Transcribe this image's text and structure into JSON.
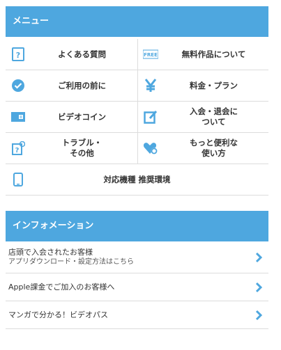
{
  "menu": {
    "title": "メニュー",
    "rows": [
      [
        {
          "label": "よくある質問",
          "icon": "faq-icon"
        },
        {
          "label": "無料作品について",
          "icon": "free-icon"
        }
      ],
      [
        {
          "label": "ご利用の前に",
          "icon": "check-badge-icon"
        },
        {
          "label": "料金・プラン",
          "icon": "yen-icon"
        }
      ],
      [
        {
          "label": "ビデオコイン",
          "icon": "coin-card-icon"
        },
        {
          "label": "入会・退会に\nついて",
          "icon": "edit-icon"
        }
      ],
      [
        {
          "label": "トラブル・\nその他",
          "icon": "trouble-icon"
        },
        {
          "label": "もっと便利な\n使い方",
          "icon": "heart-gear-icon"
        }
      ]
    ],
    "full_item": {
      "label": "対応機種 推奨環境",
      "icon": "smartphone-icon"
    }
  },
  "info": {
    "title": "インフォメーション",
    "items": [
      {
        "line1": "店頭で入会されたお客様",
        "line2": "アプリダウンロード・設定方法はこちら"
      },
      {
        "line1": "Apple課金でご加入のお客様へ"
      },
      {
        "line1": "マンガで分かる！ビデオパス"
      }
    ]
  },
  "colors": {
    "accent": "#4ea7df"
  }
}
